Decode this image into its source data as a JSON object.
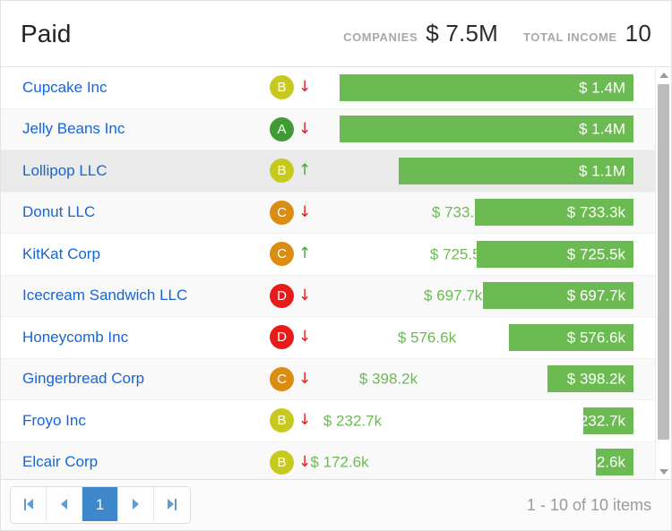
{
  "header": {
    "title": "Paid",
    "stats": [
      {
        "label": "COMPANIES",
        "value": "$ 7.5M"
      },
      {
        "label": "TOTAL INCOME",
        "value": "10"
      }
    ]
  },
  "colors": {
    "bar": "#6cbb52",
    "link": "#1565d8",
    "rating_a": "#3f9c35",
    "rating_b": "#c8c91e",
    "rating_c": "#dd8c12",
    "rating_d": "#e81a1a",
    "trend_down": "#e81a1a",
    "trend_up": "#4f9e44",
    "pager_active": "#3e87ca",
    "row_highlight": "#eaeaea"
  },
  "chart_data": {
    "type": "bar",
    "title": "Paid",
    "xlabel": "",
    "ylabel": "",
    "orientation": "horizontal",
    "categories": [
      "Cupcake Inc",
      "Jelly Beans Inc",
      "Lollipop LLC",
      "Donut LLC",
      "KitKat Corp",
      "Icecream Sandwich LLC",
      "Honeycomb Inc",
      "Gingerbread Corp",
      "Froyo Inc",
      "Elcair Corp"
    ],
    "values": [
      1400000,
      1400000,
      1100000,
      733300,
      725500,
      697700,
      576600,
      398200,
      232700,
      172600
    ],
    "value_labels": [
      "$ 1.4M",
      "$ 1.4M",
      "$ 1.1M",
      "$ 733.3k",
      "$ 725.5k",
      "$ 697.7k",
      "$ 576.6k",
      "$ 398.2k",
      "$ 232.7k",
      "$ 172.6k"
    ],
    "xlim": [
      0,
      1400000
    ],
    "grid": false,
    "legend": null
  },
  "rows": [
    {
      "name": "Cupcake Inc",
      "rating": "B",
      "rating_color": "#c8c91e",
      "trend": "down",
      "trend_glyph": "↓",
      "value_label": "$ 1.4M",
      "bar_pct": 100.0,
      "stripe": "white",
      "highlight": false
    },
    {
      "name": "Jelly Beans Inc",
      "rating": "A",
      "rating_color": "#3f9c35",
      "trend": "down",
      "trend_glyph": "↓",
      "value_label": "$ 1.4M",
      "bar_pct": 100.0,
      "stripe": "alt",
      "highlight": false
    },
    {
      "name": "Lollipop LLC",
      "rating": "B",
      "rating_color": "#c8c91e",
      "trend": "up",
      "trend_glyph": "↑",
      "value_label": "$ 1.1M",
      "bar_pct": 80.0,
      "stripe": "white",
      "highlight": true
    },
    {
      "name": "Donut LLC",
      "rating": "C",
      "rating_color": "#dd8c12",
      "trend": "down",
      "trend_glyph": "↓",
      "value_label": "$ 733.3k",
      "bar_pct": 54.0,
      "stripe": "alt",
      "highlight": false
    },
    {
      "name": "KitKat Corp",
      "rating": "C",
      "rating_color": "#dd8c12",
      "trend": "up",
      "trend_glyph": "↑",
      "value_label": "$ 725.5k",
      "bar_pct": 53.4,
      "stripe": "white",
      "highlight": false
    },
    {
      "name": "Icecream Sandwich LLC",
      "rating": "D",
      "rating_color": "#e81a1a",
      "trend": "down",
      "trend_glyph": "↓",
      "value_label": "$ 697.7k",
      "bar_pct": 51.3,
      "stripe": "alt",
      "highlight": false
    },
    {
      "name": "Honeycomb Inc",
      "rating": "D",
      "rating_color": "#e81a1a",
      "trend": "down",
      "trend_glyph": "↓",
      "value_label": "$ 576.6k",
      "bar_pct": 42.4,
      "stripe": "white",
      "highlight": false
    },
    {
      "name": "Gingerbread Corp",
      "rating": "C",
      "rating_color": "#dd8c12",
      "trend": "down",
      "trend_glyph": "↓",
      "value_label": "$ 398.2k",
      "bar_pct": 29.3,
      "stripe": "alt",
      "highlight": false
    },
    {
      "name": "Froyo Inc",
      "rating": "B",
      "rating_color": "#c8c91e",
      "trend": "down",
      "trend_glyph": "↓",
      "value_label": "$ 232.7k",
      "bar_pct": 17.1,
      "stripe": "white",
      "highlight": false
    },
    {
      "name": "Elcair Corp",
      "rating": "B",
      "rating_color": "#c8c91e",
      "trend": "down",
      "trend_glyph": "↓",
      "value_label": "$ 172.6k",
      "bar_pct": 12.7,
      "stripe": "alt",
      "highlight": false
    }
  ],
  "pager": {
    "first_label": "",
    "prev_label": "",
    "page_label": "1",
    "next_label": "",
    "last_label": "",
    "info": "1 - 10 of 10 items"
  }
}
